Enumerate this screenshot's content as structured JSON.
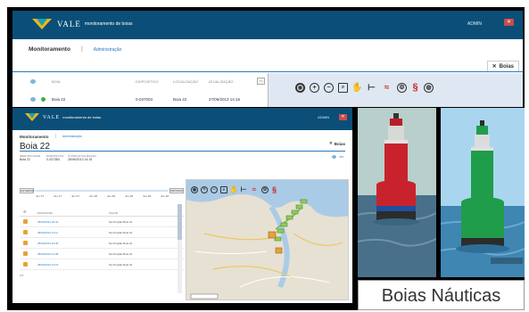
{
  "app": {
    "brand": "VALE",
    "subtitle": "monitoramento de boias",
    "user": "ADMIN"
  },
  "nav": {
    "monitoramento": "Monitoramento",
    "administracao": "Administração"
  },
  "tab": {
    "boias": "Boias"
  },
  "back_table": {
    "headers": [
      "BOIA",
      "DISPOSITIVO",
      "LOCALIZAÇÃO",
      "ATUALIZAÇÃO"
    ],
    "row": {
      "boia": "Boia 22",
      "dispositivo": "0-037003",
      "localizacao": "Boia 22",
      "atualizacao": "27/06/2013 14:15"
    }
  },
  "detail": {
    "title": "Boia 22",
    "meta_labels": [
      "IDENTIFICADOR",
      "DISPOSITIVO",
      "ÚLTIMA ATUALIZAÇÃO"
    ],
    "meta_values": [
      "Boia 22",
      "0-037383",
      "28/06/2013 14:15"
    ],
    "view_link": "ver"
  },
  "timeline": {
    "prev": "ANTERIOR",
    "next": "PRÓXIMO",
    "ticks": [
      "Jun\n27",
      "Jun\n27",
      "Jun\n27",
      "Jun\n28",
      "Jun\n28",
      "Jun\n28",
      "Jun\n28",
      "Jun\n28"
    ]
  },
  "events": {
    "headers": [
      "DATA/HORA",
      "VALOR"
    ],
    "rows": [
      {
        "time": "28/06/2013 20:41",
        "value": "Na Posição Boia 22"
      },
      {
        "time": "28/06/2013 14:11",
        "value": "Na Posição Boia 22"
      },
      {
        "time": "28/06/2013 10:39",
        "value": "Na Posição Boia 22"
      },
      {
        "time": "28/06/2013 14:08",
        "value": "Na Posição Boia 22"
      },
      {
        "time": "28/06/2013 14:16",
        "value": "Na Posição Boia 22"
      }
    ],
    "pager": "1/5"
  },
  "map_tools": [
    "layers-icon",
    "zoom-in-icon",
    "zoom-out-icon",
    "zoom-box-icon",
    "pan-icon",
    "measure-icon",
    "route-icon",
    "settings-icon",
    "pin-icon",
    "globe-icon"
  ],
  "colors": {
    "header": "#0b4f78",
    "accent": "#2a7bc0",
    "brand_yellow": "#f2b51c",
    "brand_teal": "#17a3a8",
    "buoy_red": "#c8232c",
    "buoy_green": "#1f9d4b"
  },
  "caption": "Boias Náuticas"
}
